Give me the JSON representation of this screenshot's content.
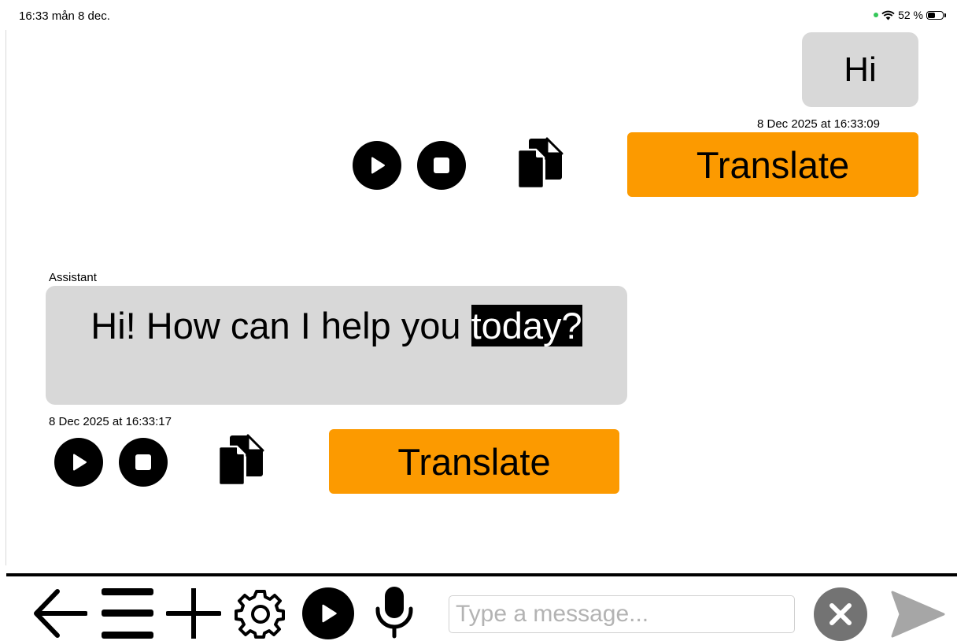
{
  "status_bar": {
    "time_date": "16:33  mån 8 dec.",
    "battery_percent": "52 %",
    "wifi_icon": "wifi-icon",
    "battery_level": 0.52
  },
  "messages": [
    {
      "role": "user",
      "text": "Hi",
      "timestamp": "8 Dec 2025 at 16:33:09",
      "translate_label": "Translate"
    },
    {
      "role": "assistant",
      "sender_label": "Assistant",
      "text_before": "Hi! How can I help you ",
      "text_highlighted": "today?",
      "timestamp": "8 Dec 2025 at 16:33:17",
      "translate_label": "Translate"
    }
  ],
  "message_actions": [
    "play-icon",
    "stop-icon",
    "copy-icon"
  ],
  "toolbar": {
    "icons": [
      "back-arrow-icon",
      "menu-icon",
      "plus-icon",
      "gear-icon",
      "play-icon",
      "microphone-icon",
      "clear-icon",
      "send-icon"
    ],
    "input_placeholder": "Type a message...",
    "input_value": ""
  },
  "colors": {
    "accent_orange": "#fc9a00",
    "bubble_gray": "#d8d8d8",
    "clear_button_gray": "#737373",
    "send_icon_gray": "#a6a6a6",
    "status_dot_green": "#34c759"
  }
}
